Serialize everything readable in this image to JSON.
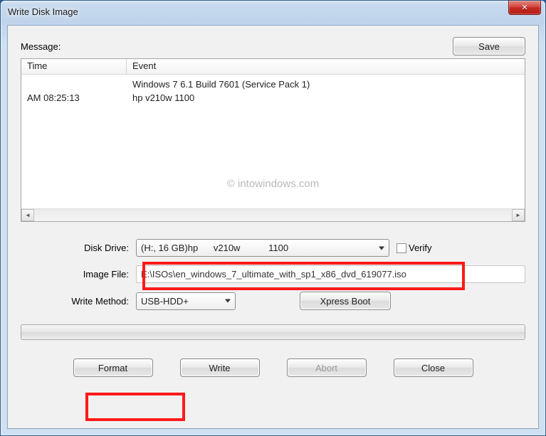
{
  "window": {
    "title": "Write Disk Image"
  },
  "buttons": {
    "save": "Save",
    "format": "Format",
    "write": "Write",
    "abort": "Abort",
    "close": "Close",
    "xpress": "Xpress Boot"
  },
  "labels": {
    "message": "Message:",
    "time_col": "Time",
    "event_col": "Event",
    "disk_drive": "Disk Drive:",
    "image_file": "Image File:",
    "write_method": "Write Method:",
    "verify": "Verify"
  },
  "messages": [
    {
      "time": "",
      "event": "Windows 7 6.1 Build 7601 (Service Pack 1)"
    },
    {
      "time": "AM 08:25:13",
      "event": "hp      v210w           1100"
    }
  ],
  "fields": {
    "disk_drive": "(H:, 16 GB)hp      v210w           1100",
    "image_file": "E:\\ISOs\\en_windows_7_ultimate_with_sp1_x86_dvd_619077.iso",
    "write_method": "USB-HDD+"
  },
  "watermark": "© intowindows.com"
}
